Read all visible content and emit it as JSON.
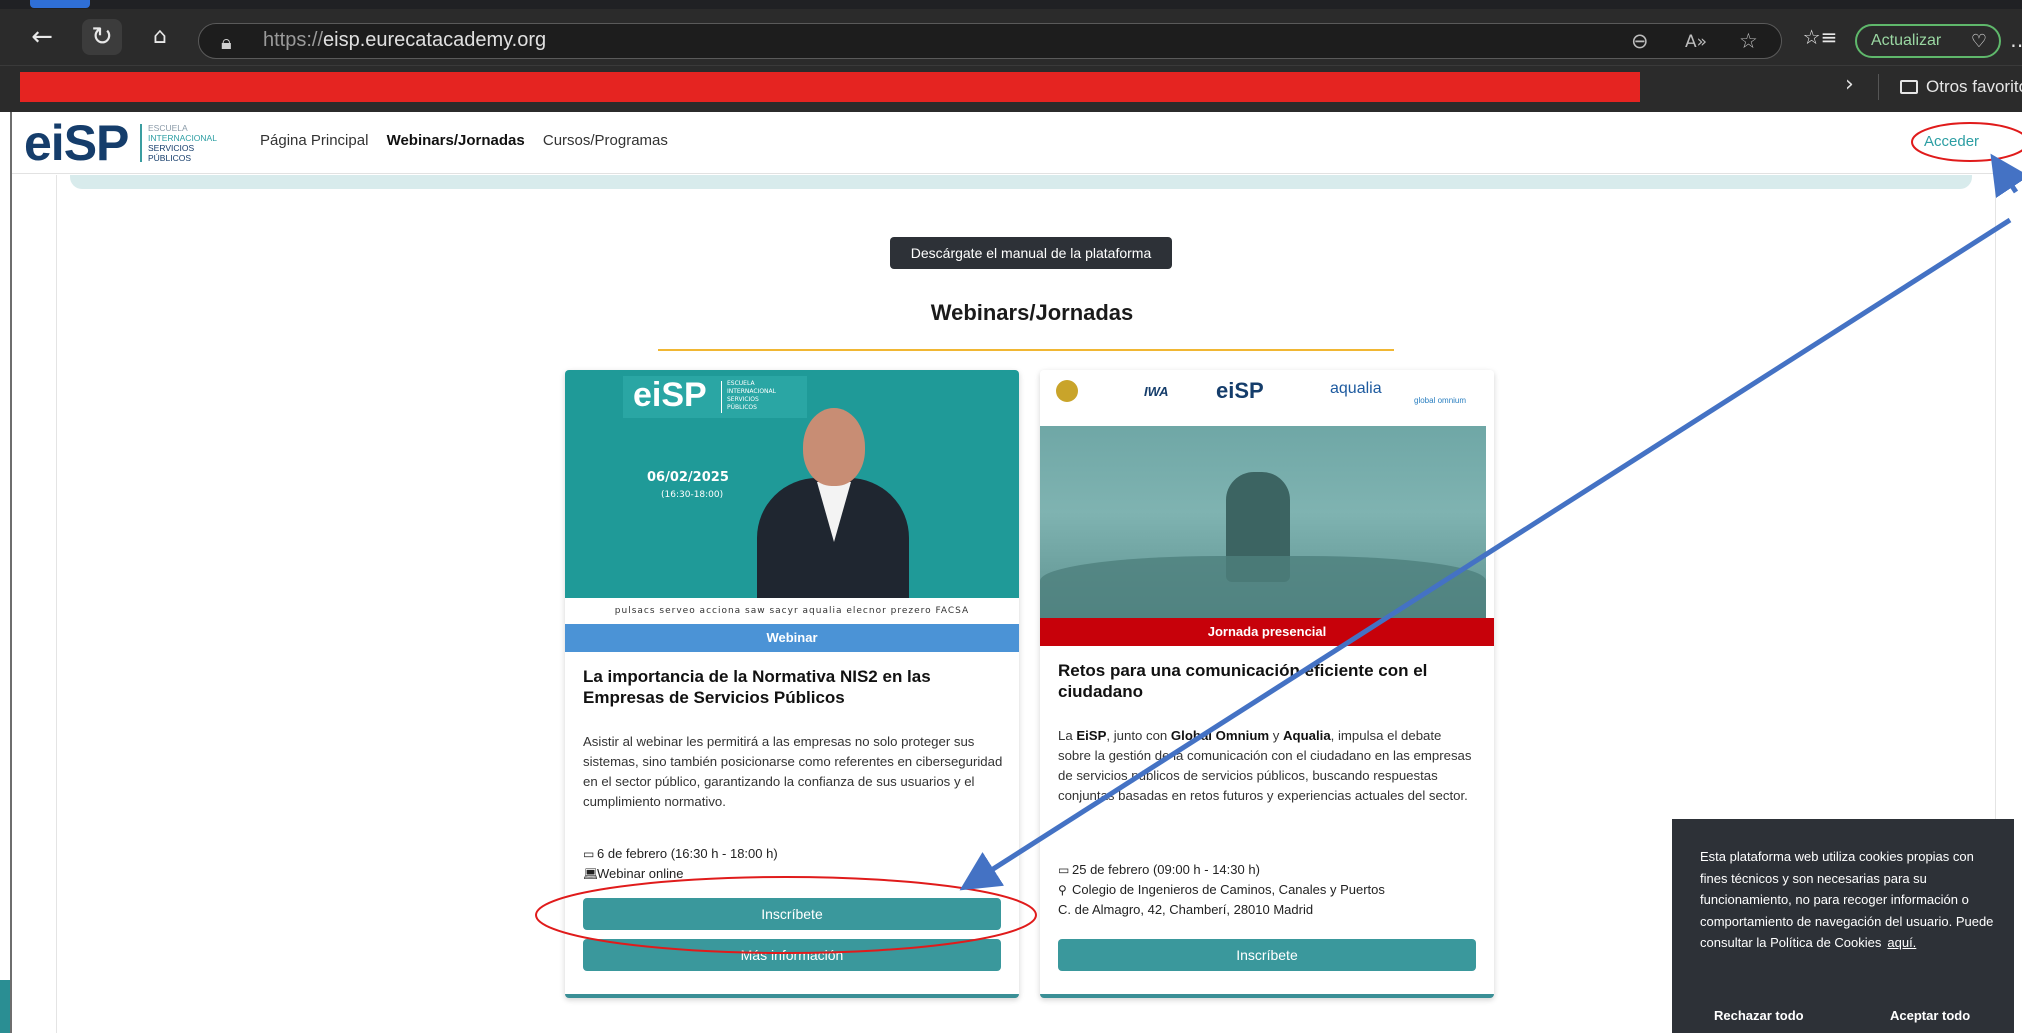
{
  "browser": {
    "url_prefix": "https://",
    "url_host": "eisp.eurecatacademy.org",
    "update_label": "Actualizar",
    "favorites_folder": "Otros favorito"
  },
  "site": {
    "logo_mark": "eiSP",
    "logo_tag": [
      "ESCUELA",
      "INTERNACIONAL",
      "SERVICIOS",
      "PÚBLICOS"
    ],
    "nav": [
      "Página Principal",
      "Webinars/Jornadas",
      "Cursos/Programas"
    ],
    "login_label": "Acceder"
  },
  "main": {
    "manual_button": "Descárgate el manual de la plataforma",
    "section_title": "Webinars/Jornadas"
  },
  "cards": [
    {
      "image_date": "06/02/2025",
      "image_time": "(16:30-18:00)",
      "image_logos": "pulsacs  serveo  acciona  saw  sacyr  aqualia  elecnor  prezero  FACSA",
      "ribbon": "Webinar",
      "title": "La importancia de la Normativa NIS2 en las Empresas de Servicios Públicos",
      "description": "Asistir al webinar les permitirá a las empresas no solo proteger sus sistemas, sino también posicionarse como referentes en ciberseguridad en el sector público, garantizando la confianza de sus usuarios y el cumplimiento normativo.",
      "date": "6 de febrero (16:30 h - 18:00 h)",
      "location": "Webinar online",
      "primary_button": "Inscríbete",
      "secondary_button": "Más información"
    },
    {
      "partners": [
        "IWA",
        "eiSP",
        "aqualia",
        "global omnium"
      ],
      "ribbon": "Jornada presencial",
      "title": "Retos para una comunicación eficiente con el ciudadano",
      "description_parts": [
        "La ",
        "EiSP",
        ", junto con ",
        "Global Omnium",
        " y ",
        "Aqualia",
        ", impulsa el debate sobre la gestión de la comunicación con el ciudadano en las empresas de servicios públicos de servicios públicos, buscando respuestas conjuntas basadas en retos futuros y experiencias actuales del sector."
      ],
      "date": "25 de febrero (09:00 h - 14:30 h)",
      "location_line1": "Colegio de Ingenieros de Caminos, Canales y Puertos",
      "location_line2": "C. de Almagro, 42, Chamberí, 28010 Madrid",
      "primary_button": "Inscríbete"
    }
  ],
  "cookie": {
    "text": "Esta plataforma web utiliza cookies propias con fines técnicos y son necesarias para su funcionamiento, no para recoger información o comportamiento de navegación del usuario. Puede consultar la Política de Cookies",
    "link": "aquí.",
    "reject": "Rechazar todo",
    "accept": "Aceptar todo"
  },
  "colors": {
    "accent_teal": "#3a989c",
    "webinar_blue": "#4b93d6",
    "presencial_red": "#c7010a",
    "annotation_red": "#e01b1b",
    "annotation_arrow": "#4472c4",
    "section_rule": "#f1b733"
  }
}
